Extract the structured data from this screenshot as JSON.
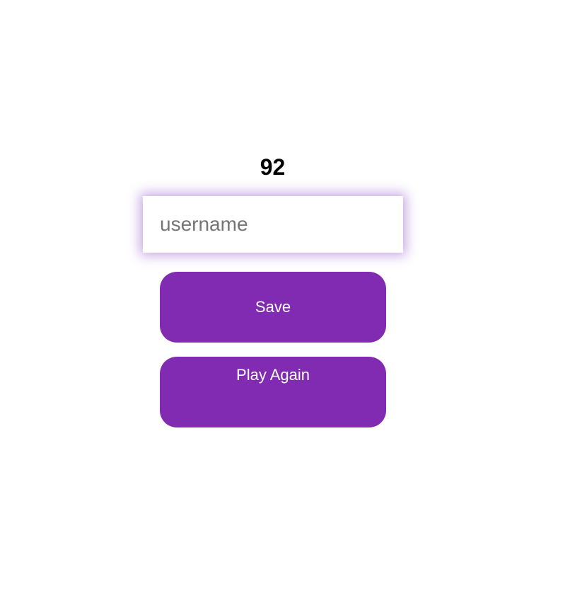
{
  "score": {
    "value": "92"
  },
  "form": {
    "username_placeholder": "username",
    "username_value": ""
  },
  "buttons": {
    "save_label": "Save",
    "play_again_label": "Play Again"
  },
  "colors": {
    "accent": "#812bb3",
    "input_glow": "#a872d6",
    "background": "#ffffff",
    "text": "#000000"
  }
}
